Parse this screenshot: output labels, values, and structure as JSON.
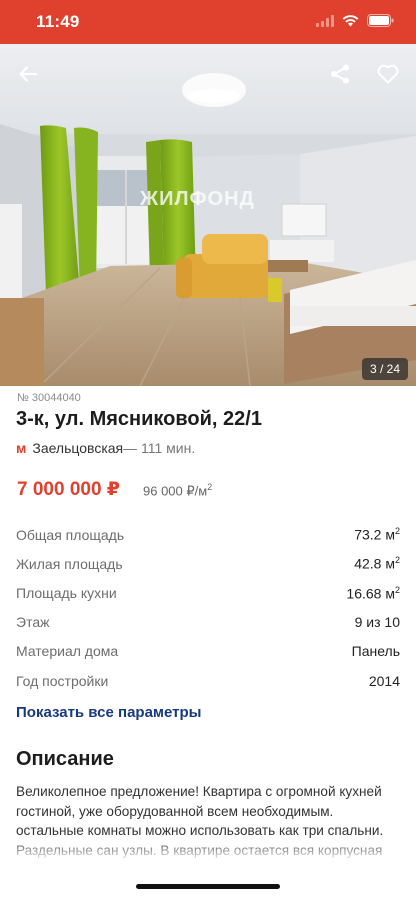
{
  "status_bar": {
    "time": "11:49"
  },
  "colors": {
    "brand": "#e0412e",
    "link": "#17397d"
  },
  "gallery": {
    "counter": "3 / 24",
    "watermark": "ЖИЛФОНД",
    "icons": {
      "back": "back-arrow-icon",
      "share": "share-icon",
      "favorite": "heart-icon"
    }
  },
  "listing": {
    "id": "№ 30044040",
    "title": "3-к, ул. Мясниковой, 22/1",
    "metro": {
      "icon": "metro-icon",
      "symbol": "м",
      "station": "Заельцовская",
      "duration": "— 111 мин."
    },
    "price": "7 000 000 ₽",
    "price_per_m2": "96 000 ₽/м",
    "price_per_m2_sup": "2"
  },
  "params": [
    {
      "label": "Общая площадь",
      "value": "73.2 м",
      "sup": "2"
    },
    {
      "label": "Жилая площадь",
      "value": "42.8 м",
      "sup": "2"
    },
    {
      "label": "Площадь кухни",
      "value": "16.68 м",
      "sup": "2"
    },
    {
      "label": "Этаж",
      "value": "9 из 10",
      "sup": ""
    },
    {
      "label": "Материал дома",
      "value": "Панель",
      "sup": ""
    },
    {
      "label": "Год постройки",
      "value": "2014",
      "sup": ""
    }
  ],
  "show_all_label": "Показать все параметры",
  "description": {
    "title": "Описание",
    "text": "Великолепное предложение! Квартира с огромной кухней гостиной, уже оборудованной всем необходимым. остальные комнаты можно использовать как три спальни. Раздельные сан узлы. В квартире остается вся корпусная мебель"
  }
}
